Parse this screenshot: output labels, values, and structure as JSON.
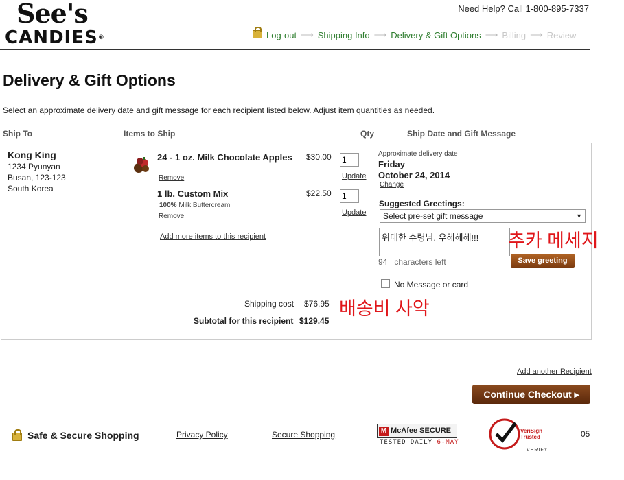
{
  "brand": {
    "line1": "See's",
    "line2": "CANDIES",
    "reg": "®"
  },
  "header": {
    "help": "Need Help? Call 1-800-895-7337",
    "steps": [
      {
        "label": "Log-out",
        "state": "active"
      },
      {
        "label": "Shipping Info",
        "state": "active"
      },
      {
        "label": "Delivery & Gift Options",
        "state": "current"
      },
      {
        "label": "Billing",
        "state": "future"
      },
      {
        "label": "Review",
        "state": "future"
      }
    ]
  },
  "page": {
    "title": "Delivery & Gift Options",
    "intro": "Select an approximate delivery date and gift message for each recipient listed below. Adjust item quantities as needed."
  },
  "columns": {
    "ship_to": "Ship To",
    "items": "Items to Ship",
    "qty": "Qty",
    "ship_date": "Ship Date and Gift Message"
  },
  "recipient": {
    "name": "Kong King",
    "address": [
      "1234 Pyunyan",
      "Busan, 123-123",
      "South Korea"
    ]
  },
  "items": [
    {
      "title": "24 - 1 oz. Milk Chocolate Apples",
      "remove": "Remove",
      "price": "$30.00",
      "qty": "1",
      "update": "Update"
    },
    {
      "title": "1 lb. Custom Mix",
      "detail_pct": "100%",
      "detail": "Milk Buttercream",
      "remove": "Remove",
      "price": "$22.50",
      "qty": "1",
      "update": "Update"
    }
  ],
  "add_more": "Add more items to this recipient",
  "delivery": {
    "label": "Approximate delivery date",
    "day": "Friday",
    "date": "October 24, 2014",
    "change": "Change"
  },
  "greetings": {
    "label": "Suggested Greetings:",
    "select": "Select pre-set gift message",
    "message": "위대한 수령님. 우헤헤헤!!!",
    "count": "94",
    "chars_left": "characters left",
    "save": "Save greeting",
    "no_message": "No Message or card"
  },
  "annotations": {
    "message": "추카 메세지",
    "shipping": "배송비 사악"
  },
  "totals": {
    "shipping_label": "Shipping cost",
    "shipping": "$76.95",
    "subtotal_label": "Subtotal for this recipient",
    "subtotal": "$129.45"
  },
  "actions": {
    "add_recipient": "Add another Recipient",
    "continue": "Continue Checkout"
  },
  "footer": {
    "secure": "Safe & Secure Shopping",
    "privacy": "Privacy Policy",
    "secure_shopping": "Secure Shopping",
    "mcafee": "McAfee SECURE",
    "tested": "TESTED DAILY",
    "tested_date": "6-MAY",
    "verisign_line1": "VeriSign",
    "verisign_line2": "Trusted",
    "verify": "VERIFY",
    "page_num": "05"
  },
  "colors": {
    "step_active": "#2e7d2e",
    "step_future": "#c8c8c8",
    "button_brown": "#7a3a0f",
    "annotation": "#e0161a"
  }
}
